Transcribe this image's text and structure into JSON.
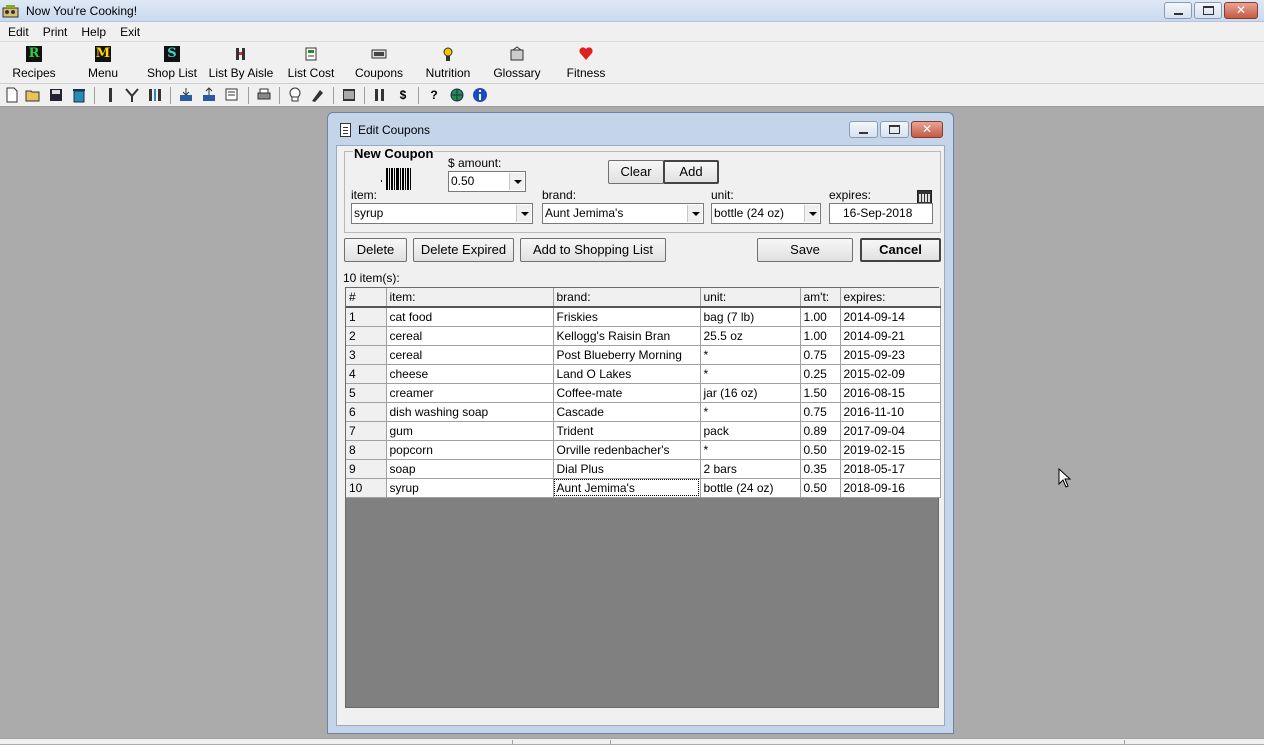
{
  "app": {
    "title": "Now You're Cooking!"
  },
  "menu": [
    {
      "label": "Edit"
    },
    {
      "label": "Print"
    },
    {
      "label": "Help"
    },
    {
      "label": "Exit"
    }
  ],
  "big_toolbar": [
    {
      "label": "Recipes",
      "icon": "R",
      "color": "#0a8a2a"
    },
    {
      "label": "Menu",
      "icon": "M",
      "color": "#d4a200"
    },
    {
      "label": "Shop List",
      "icon": "S",
      "color": "#1c8a8a"
    },
    {
      "label": "List By Aisle",
      "icon": "aisle-icon"
    },
    {
      "label": "List Cost",
      "icon": "list-cost-icon"
    },
    {
      "label": "Coupons",
      "icon": "coupon-icon"
    },
    {
      "label": "Nutrition",
      "icon": "nutrition-icon"
    },
    {
      "label": "Glossary",
      "icon": "glossary-icon"
    },
    {
      "label": "Fitness",
      "icon": "heart-icon",
      "color": "#e02020"
    }
  ],
  "dialog": {
    "title": "Edit Coupons",
    "new_coupon": {
      "group_title": "New Coupon",
      "amount_label": "$ amount:",
      "amount_value": "0.50",
      "item_label": "item:",
      "item_value": "syrup",
      "brand_label": "brand:",
      "brand_value": "Aunt Jemima's",
      "unit_label": "unit:",
      "unit_value": "bottle (24 oz)",
      "expires_label": "expires:",
      "expires_value": "16-Sep-2018",
      "clear_label": "Clear",
      "add_label": "Add"
    },
    "actions": {
      "delete_label": "Delete",
      "delete_expired_label": "Delete Expired",
      "add_to_shopping_list_label": "Add to Shopping List",
      "save_label": "Save",
      "cancel_label": "Cancel"
    },
    "count_label": "10 item(s):",
    "table": {
      "headers": [
        "#",
        "item:",
        "brand:",
        "unit:",
        "am't:",
        "expires:"
      ],
      "rows": [
        [
          "1",
          "cat food",
          "Friskies",
          "bag (7 lb)",
          "1.00",
          "2014-09-14"
        ],
        [
          "2",
          "cereal",
          "Kellogg's Raisin Bran",
          "25.5 oz",
          "1.00",
          "2014-09-21"
        ],
        [
          "3",
          "cereal",
          "Post Blueberry Morning",
          "*",
          "0.75",
          "2015-09-23"
        ],
        [
          "4",
          "cheese",
          "Land O Lakes",
          "*",
          "0.25",
          "2015-02-09"
        ],
        [
          "5",
          "creamer",
          "Coffee-mate",
          "jar (16 oz)",
          "1.50",
          "2016-08-15"
        ],
        [
          "6",
          "dish washing soap",
          "Cascade",
          "*",
          "0.75",
          "2016-11-10"
        ],
        [
          "7",
          "gum",
          "Trident",
          "pack",
          "0.89",
          "2017-09-04"
        ],
        [
          "8",
          "popcorn",
          "Orville redenbacher's",
          "*",
          "0.50",
          "2019-02-15"
        ],
        [
          "9",
          "soap",
          "Dial Plus",
          "2 bars",
          "0.35",
          "2018-05-17"
        ],
        [
          "10",
          "syrup",
          "Aunt Jemima's",
          "bottle (24 oz)",
          "0.50",
          "2018-09-16"
        ]
      ]
    }
  }
}
